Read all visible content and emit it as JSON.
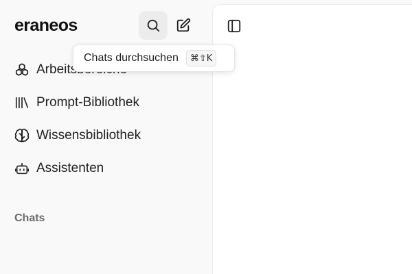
{
  "sidebar": {
    "logo_text": "eraneos",
    "search_button": {
      "icon": "search-icon"
    },
    "new_chat_button": {
      "icon": "edit-icon"
    },
    "nav_items": [
      {
        "label": "Arbeitsbereiche",
        "icon": "workspaces-icon"
      },
      {
        "label": "Prompt-Bibliothek",
        "icon": "library-icon"
      },
      {
        "label": "Wissensbibliothek",
        "icon": "brain-icon"
      },
      {
        "label": "Assistenten",
        "icon": "bot-icon"
      }
    ],
    "section_label": "Chats"
  },
  "tooltip": {
    "text": "Chats durchsuchen",
    "shortcut": "⌘⇧K"
  },
  "main": {
    "toggle_icon": "sidebar-toggle-icon"
  },
  "colors": {
    "sidebar_bg": "#f9f9f9",
    "main_bg": "#ffffff",
    "active_icon_bg": "#ececec",
    "section_label": "#6b6b6b"
  }
}
